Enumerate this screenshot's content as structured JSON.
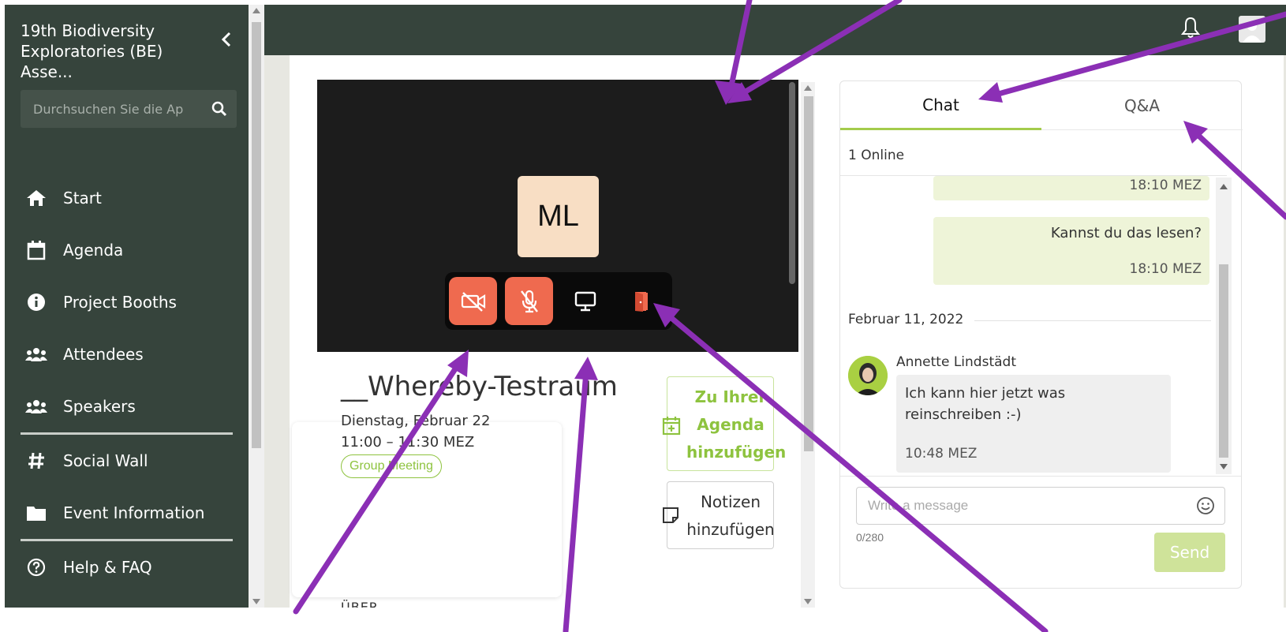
{
  "sidebar": {
    "title": "19th Biodiversity Exploratories (BE) Asse...",
    "search_placeholder": "Durchsuchen Sie die Ap",
    "items": [
      {
        "label": "Start",
        "icon": "home-icon"
      },
      {
        "label": "Agenda",
        "icon": "calendar-icon"
      },
      {
        "label": "Project Booths",
        "icon": "info-icon"
      },
      {
        "label": "Attendees",
        "icon": "users-icon"
      },
      {
        "label": "Speakers",
        "icon": "users-icon"
      },
      {
        "label": "Social Wall",
        "icon": "hashtag-icon"
      },
      {
        "label": "Event Information",
        "icon": "folder-icon"
      },
      {
        "label": "Help & FAQ",
        "icon": "question-icon"
      }
    ]
  },
  "video": {
    "participant_initials": "ML",
    "controls": [
      "camera-off-icon",
      "mic-off-icon",
      "screen-share-icon",
      "leave-room-icon"
    ]
  },
  "session": {
    "title": "__Whereby-Testraum",
    "date": "Dienstag, Februar 22",
    "time": "11:00 – 11:30 MEZ",
    "tag": "Group Meeting",
    "about_label": "ÜBER",
    "agenda_button": "Zu Ihrer Agenda hinzufügen",
    "notes_button": "Notizen hinzufügen"
  },
  "chat": {
    "tabs": [
      "Chat",
      "Q&A"
    ],
    "online": "1 Online",
    "messages": {
      "prev_time": "18:10 MEZ",
      "own_text": "Kannst du das lesen?",
      "own_time": "18:10 MEZ",
      "date_separator": "Februar 11, 2022",
      "other_name": "Annette Lindstädt",
      "other_text": "Ich kann hier jetzt was reinschreiben :-)",
      "other_time": "10:48 MEZ"
    },
    "input_placeholder": "Write a message",
    "char_count": "0/280",
    "send_label": "Send"
  },
  "colors": {
    "sidebar_bg": "#36443c",
    "accent_green": "#8ec33f",
    "control_red": "#ef6a4f",
    "arrow_purple": "#8b2fb5"
  }
}
